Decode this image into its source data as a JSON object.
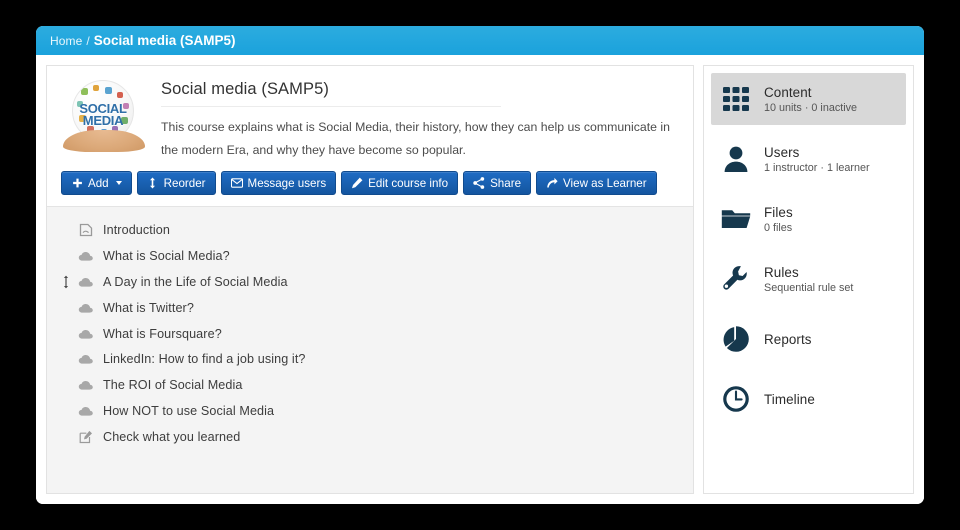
{
  "breadcrumb": {
    "home_label": "Home",
    "separator": "/",
    "current_label": "Social media (SAMP5)"
  },
  "course": {
    "title": "Social media (SAMP5)",
    "description": "This course explains what is Social Media, their history, how they can help us communicate in the modern Era, and why they have become so popular.",
    "thumbnail_text_line1": "SOCIAL",
    "thumbnail_text_line2": "MEDIA"
  },
  "toolbar": {
    "buttons": [
      {
        "label": "Add",
        "icon": "plus-icon",
        "has_caret": true
      },
      {
        "label": "Reorder",
        "icon": "reorder-icon",
        "has_caret": false
      },
      {
        "label": "Message users",
        "icon": "envelope-icon",
        "has_caret": false
      },
      {
        "label": "Edit course info",
        "icon": "pencil-icon",
        "has_caret": false
      },
      {
        "label": "Share",
        "icon": "share-icon",
        "has_caret": false
      },
      {
        "label": "View as Learner",
        "icon": "arrow-right-curve-icon",
        "has_caret": false
      }
    ]
  },
  "units": [
    {
      "label": "Introduction",
      "icon": "page-icon",
      "handle": false
    },
    {
      "label": "What is Social Media?",
      "icon": "cloud-icon",
      "handle": false
    },
    {
      "label": "A Day in the Life of Social Media",
      "icon": "cloud-icon",
      "handle": true
    },
    {
      "label": "What is Twitter?",
      "icon": "cloud-icon",
      "handle": false
    },
    {
      "label": "What is Foursquare?",
      "icon": "cloud-icon",
      "handle": false
    },
    {
      "label": "LinkedIn: How to find a job using it?",
      "icon": "cloud-icon",
      "handle": false
    },
    {
      "label": "The ROI of Social Media",
      "icon": "cloud-icon",
      "handle": false
    },
    {
      "label": "How NOT to use Social Media",
      "icon": "cloud-icon",
      "handle": false
    },
    {
      "label": "Check what you learned",
      "icon": "test-pencil-icon",
      "handle": false
    }
  ],
  "sidebar": {
    "items": [
      {
        "title": "Content",
        "subtitle": "10 units · 0 inactive",
        "icon": "grid-icon",
        "active": true
      },
      {
        "title": "Users",
        "subtitle": "1 instructor · 1 learner",
        "icon": "user-icon",
        "active": false
      },
      {
        "title": "Files",
        "subtitle": "0 files",
        "icon": "folder-icon",
        "active": false
      },
      {
        "title": "Rules",
        "subtitle": "Sequential rule set",
        "icon": "wrench-icon",
        "active": false
      },
      {
        "title": "Reports",
        "subtitle": "",
        "icon": "pie-chart-icon",
        "active": false
      },
      {
        "title": "Timeline",
        "subtitle": "",
        "icon": "clock-icon",
        "active": false
      }
    ]
  },
  "colors": {
    "header_blue": "#1ba2dc",
    "button_blue": "#14559f",
    "sidebar_icon": "#16384d",
    "active_item_bg": "#d8d8d8",
    "list_bg": "#f4f4f4"
  }
}
